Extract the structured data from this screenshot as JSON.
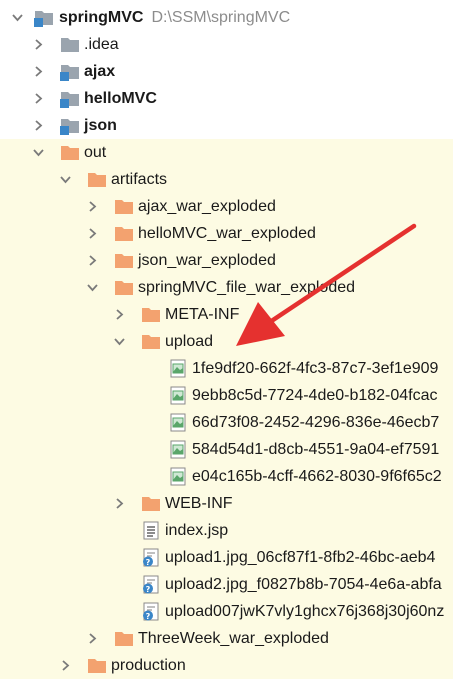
{
  "colors": {
    "folder_orange": "#f3a26f",
    "module_gray": "#9aa4ae",
    "module_blue": "#3a86c8",
    "excluded_background": "#fdfbe3",
    "annotation_arrow": "#e5312f"
  },
  "tree": {
    "root": {
      "label": "springMVC",
      "path": "D:\\SSM\\springMVC",
      "icon": "module-folder-icon"
    },
    "modules": [
      {
        "label": ".idea",
        "icon": "folder-gray-icon"
      },
      {
        "label": "ajax",
        "icon": "module-folder-icon"
      },
      {
        "label": "helloMVC",
        "icon": "module-folder-icon"
      },
      {
        "label": "json",
        "icon": "module-folder-icon"
      }
    ],
    "out": {
      "label": "out",
      "icon": "folder-orange-icon"
    },
    "artifacts": {
      "label": "artifacts",
      "icon": "folder-orange-icon"
    },
    "exploded": [
      {
        "label": "ajax_war_exploded"
      },
      {
        "label": "helloMVC_war_exploded"
      },
      {
        "label": "json_war_exploded"
      },
      {
        "label": "springMVC_file_war_exploded"
      }
    ],
    "meta_inf": {
      "label": "META-INF"
    },
    "upload": {
      "label": "upload"
    },
    "upload_files": [
      {
        "label": "1fe9df20-662f-4fc3-87c7-3ef1e909",
        "icon": "image-file-icon"
      },
      {
        "label": "9ebb8c5d-7724-4de0-b182-04fcac",
        "icon": "image-file-icon"
      },
      {
        "label": "66d73f08-2452-4296-836e-46ecb7",
        "icon": "image-file-icon"
      },
      {
        "label": "584d54d1-d8cb-4551-9a04-ef7591",
        "icon": "image-file-icon"
      },
      {
        "label": "e04c165b-4cff-4662-8030-9f6f65c2",
        "icon": "image-file-icon"
      }
    ],
    "web_inf": {
      "label": "WEB-INF"
    },
    "index_jsp": {
      "label": "index.jsp",
      "icon": "jsp-file-icon"
    },
    "unknown_files": [
      {
        "label": "upload1.jpg_06cf87f1-8fb2-46bc-aeb4",
        "icon": "unknown-file-icon"
      },
      {
        "label": "upload2.jpg_f0827b8b-7054-4e6a-abfa",
        "icon": "unknown-file-icon"
      },
      {
        "label": "upload007jwK7vly1ghcx76j368j30j60nz",
        "icon": "unknown-file-icon"
      }
    ],
    "threeweek": {
      "label": "ThreeWeek_war_exploded"
    },
    "production": {
      "label": "production"
    }
  }
}
